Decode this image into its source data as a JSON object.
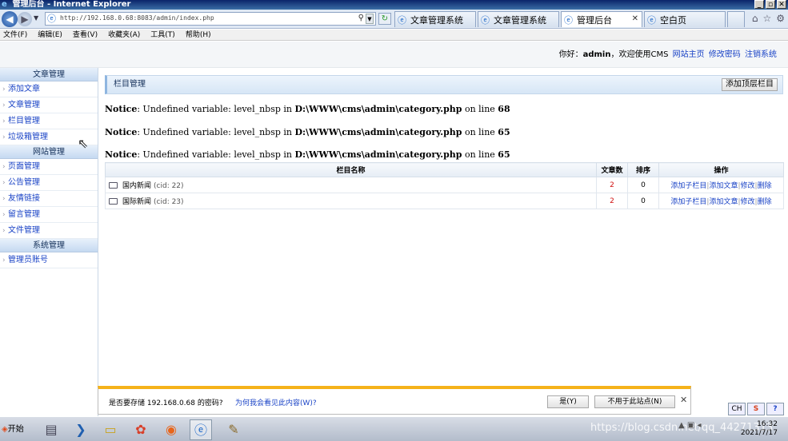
{
  "window": {
    "title": "管理后台 - Internet Explorer",
    "controls": [
      "_",
      "▫",
      "✕"
    ]
  },
  "browser": {
    "url": "http://192.168.0.68:8083/admin/index.php",
    "tabs": [
      {
        "label": "文章管理系统",
        "active": false
      },
      {
        "label": "文章管理系统",
        "active": false
      },
      {
        "label": "管理后台",
        "active": true
      },
      {
        "label": "空白页",
        "active": false
      }
    ],
    "menu": [
      "文件(F)",
      "编辑(E)",
      "查看(V)",
      "收藏夹(A)",
      "工具(T)",
      "帮助(H)"
    ]
  },
  "header": {
    "greeting": "你好：",
    "username": "admin",
    "welcome": "，欢迎使用CMS",
    "links": [
      "网站主页",
      "修改密码",
      "注销系统"
    ]
  },
  "sidebar": {
    "sections": [
      {
        "title": "文章管理",
        "items": [
          "添加文章",
          "文章管理",
          "栏目管理",
          "垃圾箱管理"
        ]
      },
      {
        "title": "网站管理",
        "items": [
          "页面管理",
          "公告管理",
          "友情链接",
          "留言管理",
          "文件管理"
        ]
      },
      {
        "title": "系统管理",
        "items": [
          "管理员账号"
        ]
      }
    ]
  },
  "main": {
    "panel_title": "栏目管理",
    "add_top_button": "添加顶层栏目",
    "notices": [
      {
        "label": "Notice",
        "msg": ": Undefined variable: level_nbsp in ",
        "path": "D:\\WWW\\cms\\admin\\category.php",
        "online": " on line ",
        "line": "68"
      },
      {
        "label": "Notice",
        "msg": ": Undefined variable: level_nbsp in ",
        "path": "D:\\WWW\\cms\\admin\\category.php",
        "online": " on line ",
        "line": "65"
      },
      {
        "label": "Notice",
        "msg": ": Undefined variable: level_nbsp in ",
        "path": "D:\\WWW\\cms\\admin\\category.php",
        "online": " on line ",
        "line": "65"
      }
    ],
    "table": {
      "headers": [
        "栏目名称",
        "文章数",
        "排序",
        "操作"
      ],
      "rows": [
        {
          "name": "国内新闻",
          "cid": "(cid: 22)",
          "count": "2",
          "sort": "0",
          "ops": [
            "添加子栏目",
            "添加文章",
            "修改",
            "删除"
          ]
        },
        {
          "name": "国际新闻",
          "cid": "(cid: 23)",
          "count": "2",
          "sort": "0",
          "ops": [
            "添加子栏目",
            "添加文章",
            "修改",
            "删除"
          ]
        }
      ]
    }
  },
  "password_bar": {
    "message": "是否要存储 192.168.0.68 的密码?",
    "link": "为何我会看见此内容(W)?",
    "yes_label": "是(Y)",
    "never_label": "不用于此站点(N)"
  },
  "system_buttons": [
    "CH",
    "S",
    "?"
  ],
  "taskbar": {
    "start_label": "开始",
    "clock_time": "16:32",
    "clock_date": "2021/7/17",
    "watermark": "https://blog.csdn.net/qq_44271313"
  },
  "colors": {
    "link": "#1a43c6",
    "count_red": "#d01010",
    "notify_accent": "#f5b21a"
  }
}
